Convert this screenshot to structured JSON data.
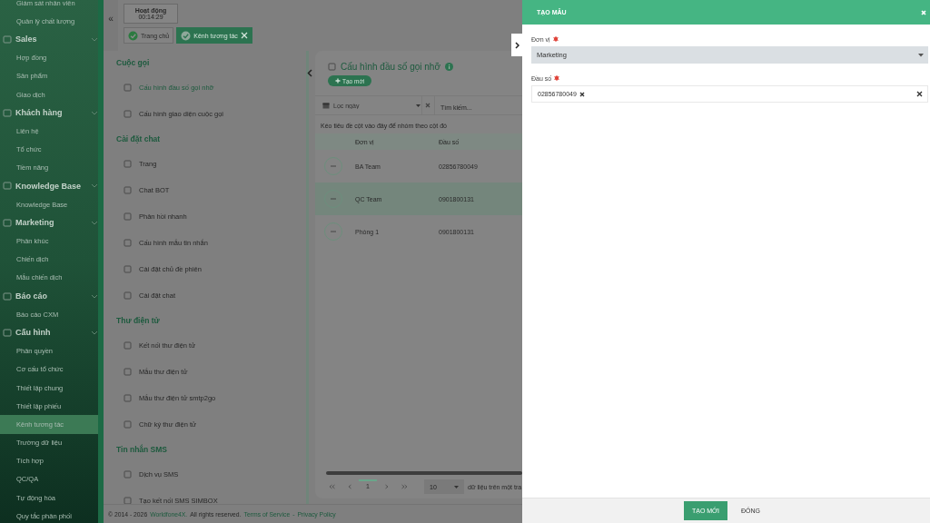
{
  "sidebar": {
    "items": [
      {
        "kind": "item",
        "label": "Giám sát nhân viên",
        "selected": false
      },
      {
        "kind": "item",
        "label": "Quản lý chất lượng",
        "selected": false
      },
      {
        "kind": "group",
        "label": "Sales",
        "selected": false
      },
      {
        "kind": "item",
        "label": "Hợp đồng",
        "selected": false
      },
      {
        "kind": "item",
        "label": "Sản phẩm",
        "selected": false
      },
      {
        "kind": "item",
        "label": "Giao dịch",
        "selected": false
      },
      {
        "kind": "group",
        "label": "Khách hàng",
        "selected": false
      },
      {
        "kind": "item",
        "label": "Liên hệ",
        "selected": false
      },
      {
        "kind": "item",
        "label": "Tổ chức",
        "selected": false
      },
      {
        "kind": "item",
        "label": "Tiềm năng",
        "selected": false
      },
      {
        "kind": "group",
        "label": "Knowledge Base",
        "selected": false
      },
      {
        "kind": "item",
        "label": "Knowledge Base",
        "selected": false
      },
      {
        "kind": "group",
        "label": "Marketing",
        "selected": false
      },
      {
        "kind": "item",
        "label": "Phân khúc",
        "selected": false
      },
      {
        "kind": "item",
        "label": "Chiến dịch",
        "selected": false
      },
      {
        "kind": "item",
        "label": "Mẫu chiến dịch",
        "selected": false
      },
      {
        "kind": "group",
        "label": "Báo cáo",
        "selected": false
      },
      {
        "kind": "item",
        "label": "Báo cáo CXM",
        "selected": false
      },
      {
        "kind": "group",
        "label": "Cấu hình",
        "selected": false
      },
      {
        "kind": "item",
        "label": "Phân quyền",
        "selected": false
      },
      {
        "kind": "item",
        "label": "Cơ cấu tổ chức",
        "selected": false
      },
      {
        "kind": "item",
        "label": "Thiết lập chung",
        "selected": false
      },
      {
        "kind": "item",
        "label": "Thiết lập phiếu",
        "selected": false
      },
      {
        "kind": "item",
        "label": "Kênh tương tác",
        "selected": true
      },
      {
        "kind": "item",
        "label": "Trường dữ liệu",
        "selected": false
      },
      {
        "kind": "item",
        "label": "Tích hợp",
        "selected": false
      },
      {
        "kind": "item",
        "label": "QC/QA",
        "selected": false
      },
      {
        "kind": "item",
        "label": "Tự động hóa",
        "selected": false
      },
      {
        "kind": "item",
        "label": "Quy tắc phân phối",
        "selected": false
      }
    ]
  },
  "collapse_button": "«",
  "timer": {
    "label": "Hoạt động",
    "time": "00:14:29"
  },
  "tabs": [
    {
      "label": "Trang chủ",
      "selected": false,
      "closable": false
    },
    {
      "label": "Kênh tương tác",
      "selected": true,
      "closable": true
    }
  ],
  "settings_menu": {
    "sections": [
      {
        "title": "Cuộc gọi",
        "items": [
          {
            "label": "Cấu hình đầu số gọi nhỡ",
            "selected": true
          },
          {
            "label": "Cấu hình giao diện cuộc gọi",
            "selected": false
          }
        ]
      },
      {
        "title": "Cài đặt chat",
        "items": [
          {
            "label": "Trang",
            "selected": false
          },
          {
            "label": "Chat BOT",
            "selected": false
          },
          {
            "label": "Phản hồi nhanh",
            "selected": false
          },
          {
            "label": "Cấu hình mẫu tin nhắn",
            "selected": false
          },
          {
            "label": "Cài đặt chủ đề phiên",
            "selected": false
          },
          {
            "label": "Cài đặt chat",
            "selected": false
          }
        ]
      },
      {
        "title": "Thư điện tử",
        "items": [
          {
            "label": "Kết nối thư điện tử",
            "selected": false
          },
          {
            "label": "Mẫu thư điện tử",
            "selected": false
          },
          {
            "label": "Mẫu thư điện tử smtp2go",
            "selected": false
          },
          {
            "label": "Chữ ký thư điện tử",
            "selected": false
          }
        ]
      },
      {
        "title": "Tin nhắn SMS",
        "items": [
          {
            "label": "Dịch vụ SMS",
            "selected": false
          },
          {
            "label": "Tạo kết nối SMS SIMBOX",
            "selected": false
          }
        ]
      }
    ]
  },
  "panel": {
    "title": "Cấu hình đầu số gọi nhỡ",
    "create_button": "Tạo mới",
    "date_filter": {
      "placeholder": "Lọc ngày"
    },
    "search": {
      "placeholder": "Tìm kiếm..."
    },
    "group_hint": "Kéo tiêu đề cột vào đây để nhóm theo cột đó",
    "table": {
      "columns": [
        "Đơn vị",
        "Đầu số"
      ],
      "rows": [
        {
          "cells": [
            "BA Team",
            "02856780049"
          ],
          "selected": false
        },
        {
          "cells": [
            "QC Team",
            "0901800131"
          ],
          "selected": true
        },
        {
          "cells": [
            "Phòng 1",
            "0901800131"
          ],
          "selected": false
        }
      ]
    },
    "pagination": {
      "page": "1",
      "page_size": "10",
      "page_size_label": "dữ liệu trên một tra"
    }
  },
  "footer": {
    "copyright": "© 2014 - 2026",
    "brand": "Worldfone4X.",
    "rights": "All rights reserved.",
    "links": [
      "Terms of Service",
      "Privacy Policy"
    ],
    "link_separator": "-"
  },
  "drawer": {
    "title": "TẠO MẪU",
    "fields": [
      {
        "kind": "select",
        "label": "Đơn vị",
        "required": true,
        "value": "Marketing"
      },
      {
        "kind": "tags",
        "label": "Đầu số",
        "required": true,
        "tags": [
          "02856780049"
        ]
      }
    ],
    "buttons": [
      {
        "label": "TẠO MỚI",
        "primary": true
      },
      {
        "label": "ĐÓNG",
        "primary": false
      }
    ]
  }
}
